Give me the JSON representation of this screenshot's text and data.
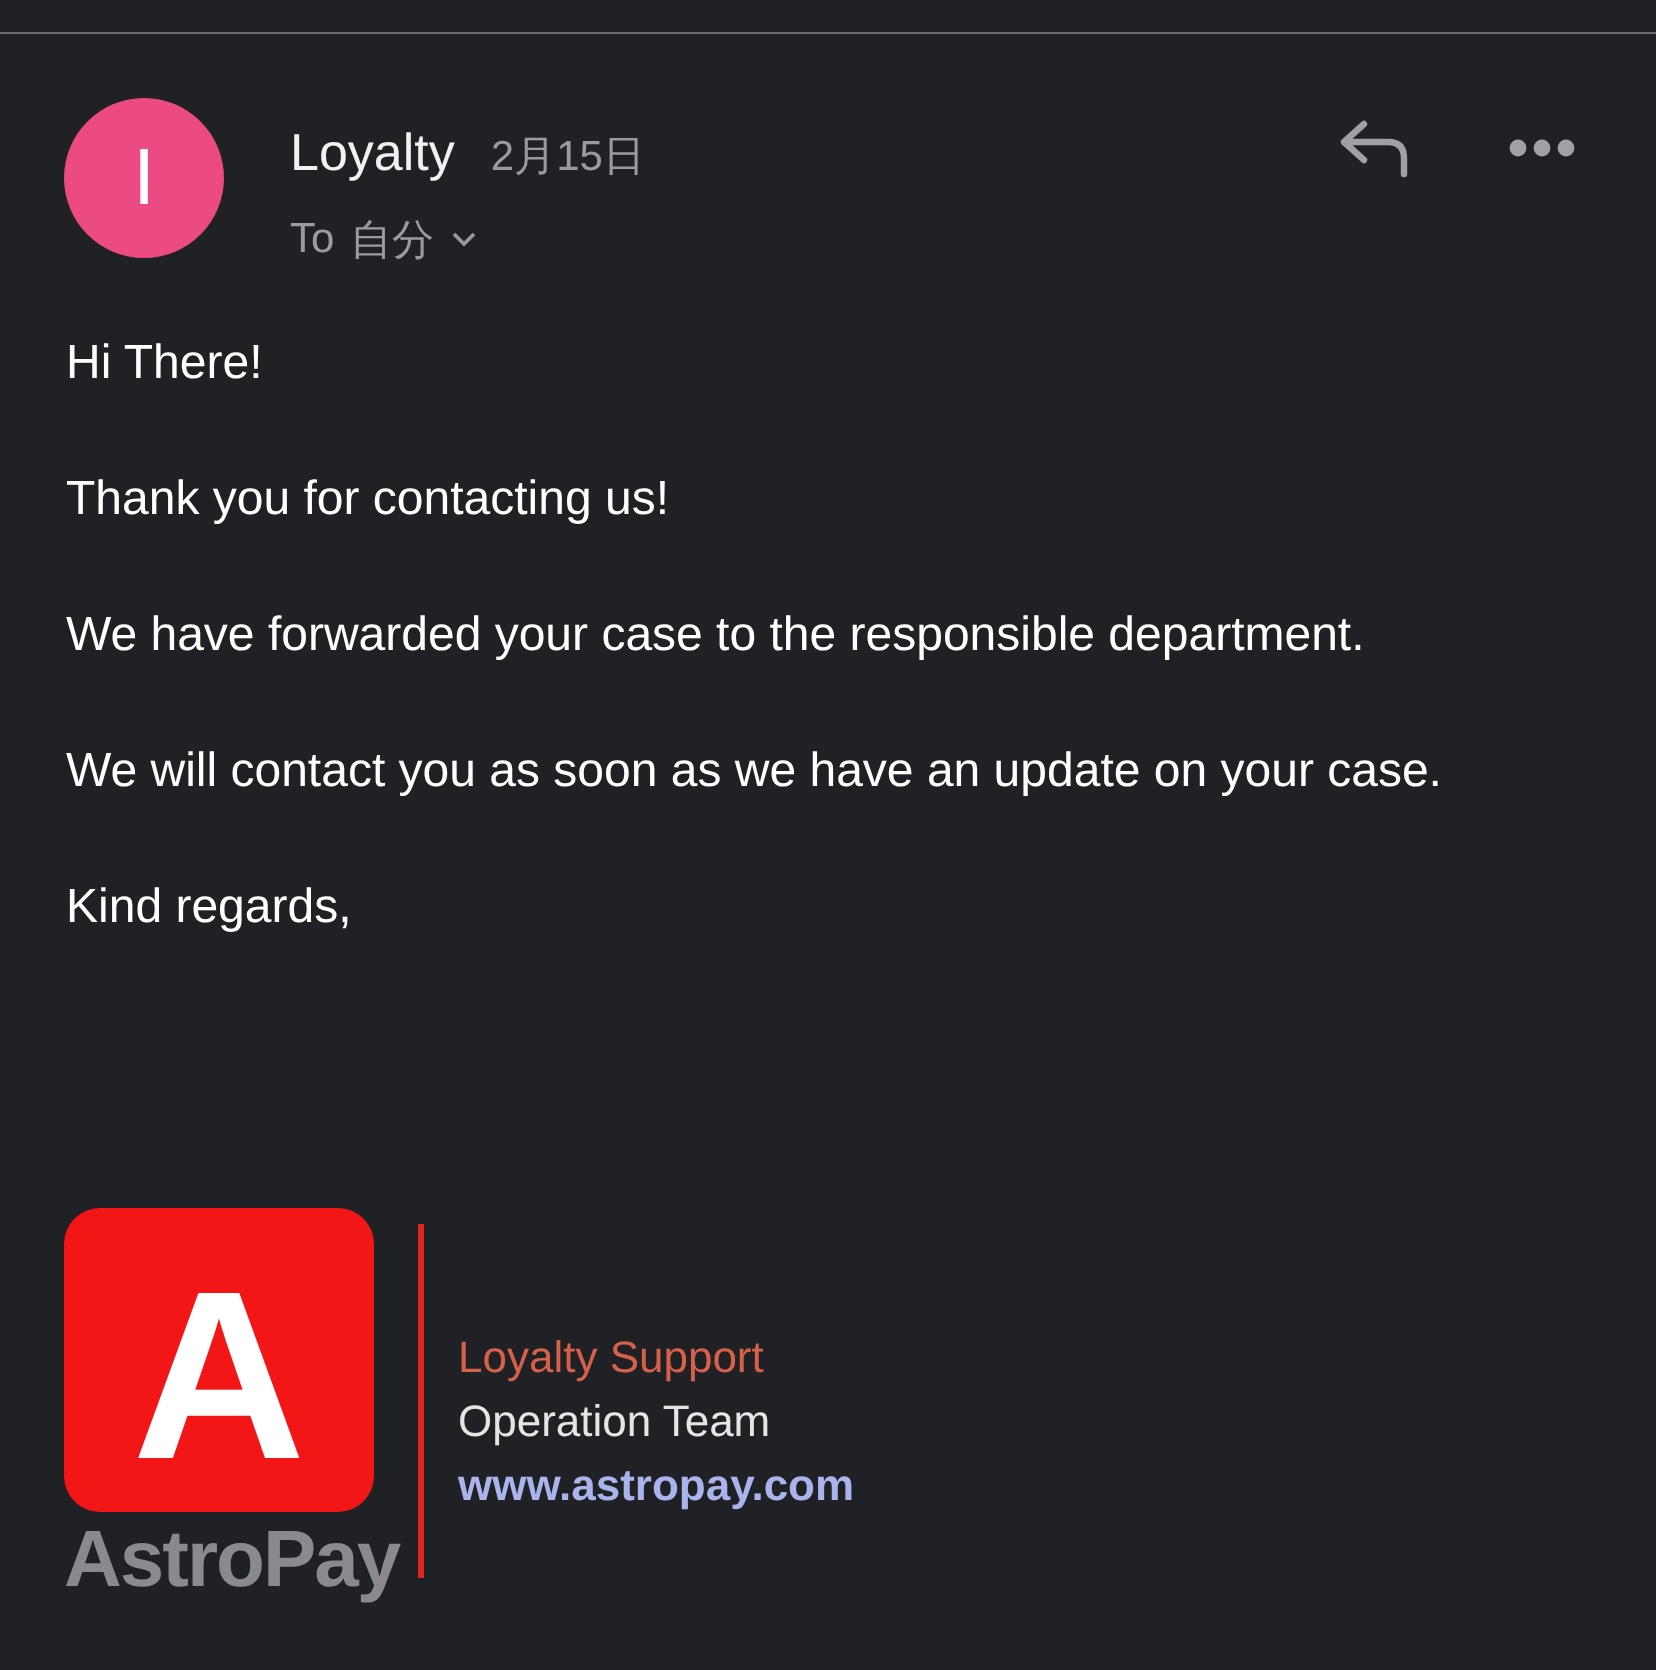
{
  "email": {
    "sender_initial": "I",
    "sender": "Loyalty",
    "date": "2月15日",
    "recipient_prefix": "To",
    "recipient": "自分"
  },
  "body": [
    "Hi There!",
    "Thank you for contacting us!",
    "We have forwarded your case to the responsible department.",
    "We will contact you as soon as we have an update on your case.",
    "Kind regards,"
  ],
  "signature": {
    "logo_letter": "A",
    "logo_wordmark": "AstroPay",
    "title": "Loyalty Support",
    "team": "Operation Team",
    "website": "www.astropay.com"
  }
}
